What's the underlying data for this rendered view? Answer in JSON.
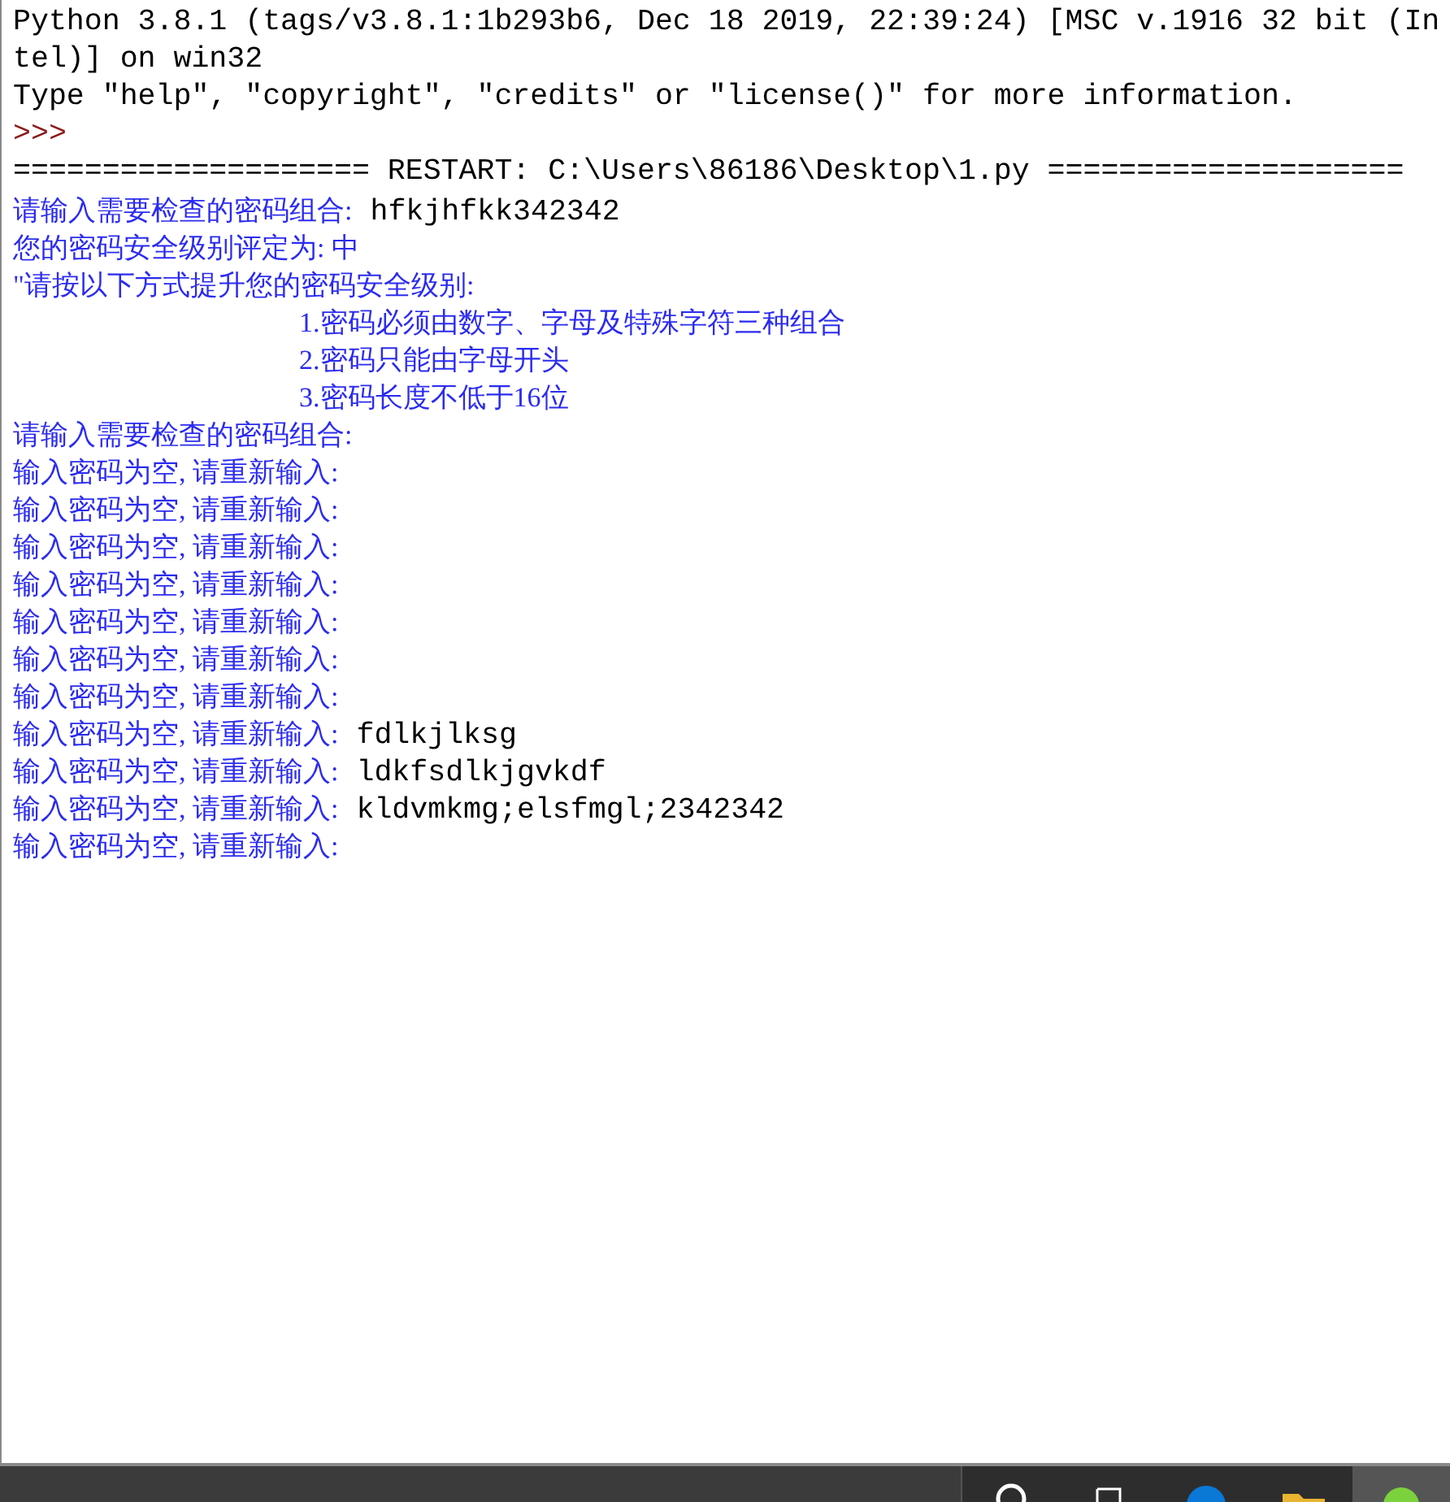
{
  "shell": {
    "lines": [
      {
        "kind": "plain",
        "segments": [
          {
            "kind": "banner",
            "text": "Python 3.8.1 (tags/v3.8.1:1b293b6, Dec 18 2019, 22:39:24) [MSC v.1916 32 bit (In"
          }
        ]
      },
      {
        "kind": "plain",
        "segments": [
          {
            "kind": "banner",
            "text": "tel)] on win32"
          }
        ]
      },
      {
        "kind": "plain",
        "segments": [
          {
            "kind": "banner",
            "text": "Type \"help\", \"copyright\", \"credits\" or \"license()\" for more information."
          }
        ]
      },
      {
        "kind": "plain",
        "segments": [
          {
            "kind": "prompt",
            "text": ">>>"
          }
        ]
      },
      {
        "kind": "plain",
        "segments": [
          {
            "kind": "banner",
            "text": "==================== RESTART: C:\\Users\\86186\\Desktop\\1.py ===================="
          }
        ]
      },
      {
        "kind": "plain",
        "segments": [
          {
            "kind": "output",
            "text": "请输入需要检查的密码组合:"
          },
          {
            "kind": "input",
            "text": "hfkjhfkk342342"
          }
        ]
      },
      {
        "kind": "plain",
        "segments": [
          {
            "kind": "output",
            "text": "您的密码安全级别评定为: 中"
          }
        ]
      },
      {
        "kind": "plain",
        "segments": [
          {
            "kind": "output",
            "text": "\"请按以下方式提升您的密码安全级别:"
          }
        ]
      },
      {
        "kind": "indented",
        "segments": [
          {
            "kind": "output",
            "text": "1.密码必须由数字、字母及特殊字符三种组合"
          }
        ]
      },
      {
        "kind": "indented",
        "segments": [
          {
            "kind": "output",
            "text": "2.密码只能由字母开头"
          }
        ]
      },
      {
        "kind": "indented",
        "segments": [
          {
            "kind": "output",
            "text": "3.密码长度不低于16位"
          }
        ]
      },
      {
        "kind": "plain",
        "segments": [
          {
            "kind": "output",
            "text": "请输入需要检查的密码组合:"
          }
        ]
      },
      {
        "kind": "plain",
        "segments": [
          {
            "kind": "output",
            "text": "输入密码为空, 请重新输入:"
          }
        ]
      },
      {
        "kind": "plain",
        "segments": [
          {
            "kind": "output",
            "text": "输入密码为空, 请重新输入:"
          }
        ]
      },
      {
        "kind": "plain",
        "segments": [
          {
            "kind": "output",
            "text": "输入密码为空, 请重新输入:"
          }
        ]
      },
      {
        "kind": "plain",
        "segments": [
          {
            "kind": "output",
            "text": "输入密码为空, 请重新输入:"
          }
        ]
      },
      {
        "kind": "plain",
        "segments": [
          {
            "kind": "output",
            "text": "输入密码为空, 请重新输入:"
          }
        ]
      },
      {
        "kind": "plain",
        "segments": [
          {
            "kind": "output",
            "text": "输入密码为空, 请重新输入:"
          }
        ]
      },
      {
        "kind": "plain",
        "segments": [
          {
            "kind": "output",
            "text": "输入密码为空, 请重新输入:"
          }
        ]
      },
      {
        "kind": "plain",
        "segments": [
          {
            "kind": "output",
            "text": "输入密码为空, 请重新输入:"
          },
          {
            "kind": "input",
            "text": "fdlkjlksg"
          }
        ]
      },
      {
        "kind": "plain",
        "segments": [
          {
            "kind": "output",
            "text": "输入密码为空, 请重新输入:"
          },
          {
            "kind": "input",
            "text": "ldkfsdlkjgvkdf"
          }
        ]
      },
      {
        "kind": "plain",
        "segments": [
          {
            "kind": "output",
            "text": "输入密码为空, 请重新输入:"
          },
          {
            "kind": "input",
            "text": "kldvmkmg;elsfmgl;2342342"
          }
        ]
      },
      {
        "kind": "plain",
        "segments": [
          {
            "kind": "output",
            "text": "输入密码为空, 请重新输入:"
          }
        ]
      }
    ]
  }
}
